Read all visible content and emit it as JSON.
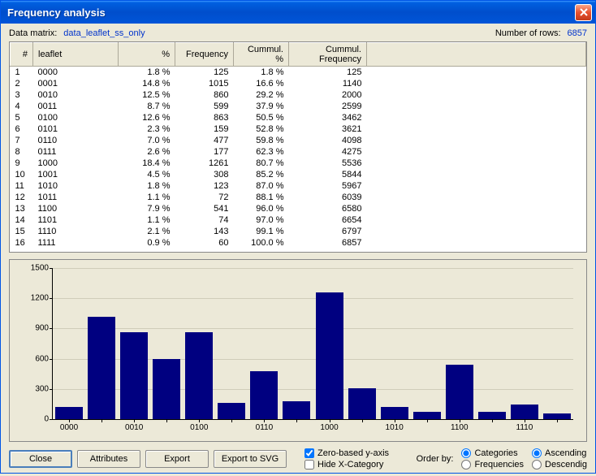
{
  "window": {
    "title": "Frequency analysis"
  },
  "info": {
    "matrix_label": "Data matrix:",
    "matrix_value": "data_leaflet_ss_only",
    "rows_label": "Number of rows:",
    "rows_value": "6857"
  },
  "table": {
    "headers": {
      "idx": "#",
      "leaflet": "leaflet",
      "pct": "%",
      "freq": "Frequency",
      "cpct": "Cummul. %",
      "cfreq": "Cummul. Frequency"
    },
    "rows": [
      {
        "idx": "1",
        "leaflet": "0000",
        "pct": "1.8 %",
        "freq": "125",
        "cpct": "1.8 %",
        "cfreq": "125"
      },
      {
        "idx": "2",
        "leaflet": "0001",
        "pct": "14.8 %",
        "freq": "1015",
        "cpct": "16.6 %",
        "cfreq": "1140"
      },
      {
        "idx": "3",
        "leaflet": "0010",
        "pct": "12.5 %",
        "freq": "860",
        "cpct": "29.2 %",
        "cfreq": "2000"
      },
      {
        "idx": "4",
        "leaflet": "0011",
        "pct": "8.7 %",
        "freq": "599",
        "cpct": "37.9 %",
        "cfreq": "2599"
      },
      {
        "idx": "5",
        "leaflet": "0100",
        "pct": "12.6 %",
        "freq": "863",
        "cpct": "50.5 %",
        "cfreq": "3462"
      },
      {
        "idx": "6",
        "leaflet": "0101",
        "pct": "2.3 %",
        "freq": "159",
        "cpct": "52.8 %",
        "cfreq": "3621"
      },
      {
        "idx": "7",
        "leaflet": "0110",
        "pct": "7.0 %",
        "freq": "477",
        "cpct": "59.8 %",
        "cfreq": "4098"
      },
      {
        "idx": "8",
        "leaflet": "0111",
        "pct": "2.6 %",
        "freq": "177",
        "cpct": "62.3 %",
        "cfreq": "4275"
      },
      {
        "idx": "9",
        "leaflet": "1000",
        "pct": "18.4 %",
        "freq": "1261",
        "cpct": "80.7 %",
        "cfreq": "5536"
      },
      {
        "idx": "10",
        "leaflet": "1001",
        "pct": "4.5 %",
        "freq": "308",
        "cpct": "85.2 %",
        "cfreq": "5844"
      },
      {
        "idx": "11",
        "leaflet": "1010",
        "pct": "1.8 %",
        "freq": "123",
        "cpct": "87.0 %",
        "cfreq": "5967"
      },
      {
        "idx": "12",
        "leaflet": "1011",
        "pct": "1.1 %",
        "freq": "72",
        "cpct": "88.1 %",
        "cfreq": "6039"
      },
      {
        "idx": "13",
        "leaflet": "1100",
        "pct": "7.9 %",
        "freq": "541",
        "cpct": "96.0 %",
        "cfreq": "6580"
      },
      {
        "idx": "14",
        "leaflet": "1101",
        "pct": "1.1 %",
        "freq": "74",
        "cpct": "97.0 %",
        "cfreq": "6654"
      },
      {
        "idx": "15",
        "leaflet": "1110",
        "pct": "2.1 %",
        "freq": "143",
        "cpct": "99.1 %",
        "cfreq": "6797"
      },
      {
        "idx": "16",
        "leaflet": "1111",
        "pct": "0.9 %",
        "freq": "60",
        "cpct": "100.0 %",
        "cfreq": "6857"
      }
    ]
  },
  "chart_data": {
    "type": "bar",
    "categories": [
      "0000",
      "0001",
      "0010",
      "0011",
      "0100",
      "0101",
      "0110",
      "0111",
      "1000",
      "1001",
      "1010",
      "1011",
      "1100",
      "1101",
      "1110",
      "1111"
    ],
    "values": [
      125,
      1015,
      860,
      599,
      863,
      159,
      477,
      177,
      1261,
      308,
      123,
      72,
      541,
      74,
      143,
      60
    ],
    "ylim": [
      0,
      1500
    ],
    "yticks": [
      0,
      300,
      600,
      900,
      1200,
      1500
    ],
    "xticks_shown": [
      "0000",
      "0010",
      "0100",
      "0110",
      "1000",
      "1010",
      "1100",
      "1110"
    ]
  },
  "buttons": {
    "close": "Close",
    "attributes": "Attributes",
    "export": "Export",
    "export_svg": "Export to SVG"
  },
  "options": {
    "zero_y": "Zero-based y-axis",
    "hide_x": "Hide X-Category",
    "order_by": "Order by:",
    "categories": "Categories",
    "frequencies": "Frequencies",
    "ascending": "Ascending",
    "descending": "Descendig"
  }
}
